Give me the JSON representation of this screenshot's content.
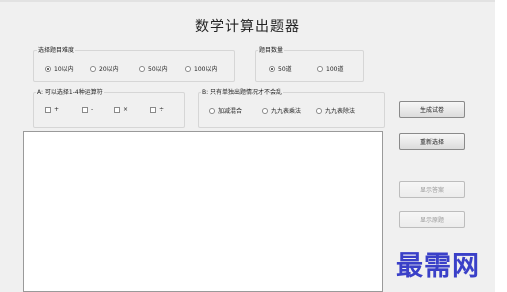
{
  "title": "数学计算出题器",
  "difficulty": {
    "label": "选择题目难度",
    "options": [
      "10以内",
      "20以内",
      "50以内",
      "100以内"
    ]
  },
  "quantity": {
    "label": "题目数量",
    "options": [
      "50道",
      "100道"
    ]
  },
  "section_a": {
    "label": "A: 可以选择1-4种运算符",
    "operators": [
      "+",
      "-",
      "×",
      "÷"
    ]
  },
  "section_b": {
    "label": "B: 只有单独出题情况才不会乱",
    "options": [
      "加减混合",
      "九九表乘法",
      "九九表除法"
    ]
  },
  "buttons": {
    "generate": "生成试卷",
    "reset": "重新选择",
    "show_answer": "显示答案",
    "show_question": "显示原题"
  },
  "watermark": "最需网"
}
